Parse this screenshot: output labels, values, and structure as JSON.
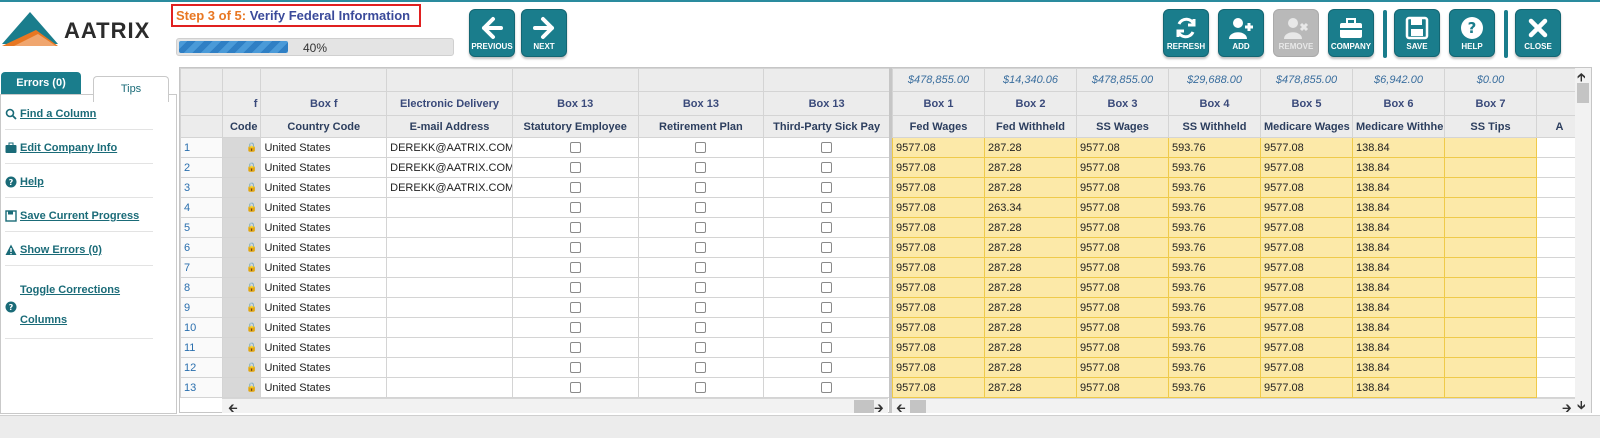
{
  "app": {
    "logo_text": "AATRIX"
  },
  "step": {
    "number": "Step 3 of 5:",
    "title": "Verify Federal Information"
  },
  "progress": {
    "percent": 40,
    "label": "40%"
  },
  "toolbar": {
    "previous": "PREVIOUS",
    "next": "NEXT",
    "refresh": "REFRESH",
    "add": "ADD",
    "remove": "REMOVE",
    "company": "COMPANY",
    "save": "SAVE",
    "help": "HELP",
    "close": "CLOSE"
  },
  "tabs": {
    "errors": "Errors (0)",
    "tips": "Tips"
  },
  "tips": [
    {
      "icon": "search-icon",
      "label": "Find a Column"
    },
    {
      "icon": "briefcase-icon",
      "label": "Edit Company Info"
    },
    {
      "icon": "help-icon",
      "label": "Help"
    },
    {
      "icon": "save-icon",
      "label": "Save Current Progress"
    },
    {
      "icon": "warning-icon",
      "label": "Show Errors (0)"
    },
    {
      "icon": "help-icon",
      "label": "Toggle Corrections Columns"
    }
  ],
  "left_grid": {
    "header_row1": [
      "",
      "",
      "",
      "",
      "",
      ""
    ],
    "header_row2": [
      "f",
      "Box f",
      "Electronic Delivery",
      "Box 13",
      "Box 13",
      "Box 13"
    ],
    "header_row3": [
      "Code",
      "Country Code",
      "E-mail Address",
      "Statutory Employee",
      "Retirement Plan",
      "Third-Party Sick Pay"
    ],
    "rows": [
      {
        "n": "1",
        "country": "United States",
        "email": "DEREKK@AATRIX.COM"
      },
      {
        "n": "2",
        "country": "United States",
        "email": "DEREKK@AATRIX.COM"
      },
      {
        "n": "3",
        "country": "United States",
        "email": "DEREKK@AATRIX.COM"
      },
      {
        "n": "4",
        "country": "United States",
        "email": ""
      },
      {
        "n": "5",
        "country": "United States",
        "email": ""
      },
      {
        "n": "6",
        "country": "United States",
        "email": ""
      },
      {
        "n": "7",
        "country": "United States",
        "email": ""
      },
      {
        "n": "8",
        "country": "United States",
        "email": ""
      },
      {
        "n": "9",
        "country": "United States",
        "email": ""
      },
      {
        "n": "10",
        "country": "United States",
        "email": ""
      },
      {
        "n": "11",
        "country": "United States",
        "email": ""
      },
      {
        "n": "12",
        "country": "United States",
        "email": ""
      },
      {
        "n": "13",
        "country": "United States",
        "email": ""
      }
    ]
  },
  "right_grid": {
    "totals": [
      "$478,855.00",
      "$14,340.06",
      "$478,855.00",
      "$29,688.00",
      "$478,855.00",
      "$6,942.00",
      "$0.00",
      ""
    ],
    "boxes": [
      "Box 1",
      "Box 2",
      "Box 3",
      "Box 4",
      "Box 5",
      "Box 6",
      "Box 7",
      ""
    ],
    "names": [
      "Fed Wages",
      "Fed Withheld",
      "SS Wages",
      "SS Withheld",
      "Medicare Wages",
      "Medicare Withheld",
      "SS Tips",
      "A"
    ],
    "rows": [
      [
        "9577.08",
        "287.28",
        "9577.08",
        "593.76",
        "9577.08",
        "138.84",
        ""
      ],
      [
        "9577.08",
        "287.28",
        "9577.08",
        "593.76",
        "9577.08",
        "138.84",
        ""
      ],
      [
        "9577.08",
        "287.28",
        "9577.08",
        "593.76",
        "9577.08",
        "138.84",
        ""
      ],
      [
        "9577.08",
        "263.34",
        "9577.08",
        "593.76",
        "9577.08",
        "138.84",
        ""
      ],
      [
        "9577.08",
        "287.28",
        "9577.08",
        "593.76",
        "9577.08",
        "138.84",
        ""
      ],
      [
        "9577.08",
        "287.28",
        "9577.08",
        "593.76",
        "9577.08",
        "138.84",
        ""
      ],
      [
        "9577.08",
        "287.28",
        "9577.08",
        "593.76",
        "9577.08",
        "138.84",
        ""
      ],
      [
        "9577.08",
        "287.28",
        "9577.08",
        "593.76",
        "9577.08",
        "138.84",
        ""
      ],
      [
        "9577.08",
        "287.28",
        "9577.08",
        "593.76",
        "9577.08",
        "138.84",
        ""
      ],
      [
        "9577.08",
        "287.28",
        "9577.08",
        "593.76",
        "9577.08",
        "138.84",
        ""
      ],
      [
        "9577.08",
        "287.28",
        "9577.08",
        "593.76",
        "9577.08",
        "138.84",
        ""
      ],
      [
        "9577.08",
        "287.28",
        "9577.08",
        "593.76",
        "9577.08",
        "138.84",
        ""
      ],
      [
        "9577.08",
        "287.28",
        "9577.08",
        "593.76",
        "9577.08",
        "138.84",
        ""
      ]
    ]
  },
  "colors": {
    "accent": "#1a7d8c",
    "highlight": "#fce9a8",
    "step_number": "#e87722",
    "step_title": "#3a4a9a"
  }
}
